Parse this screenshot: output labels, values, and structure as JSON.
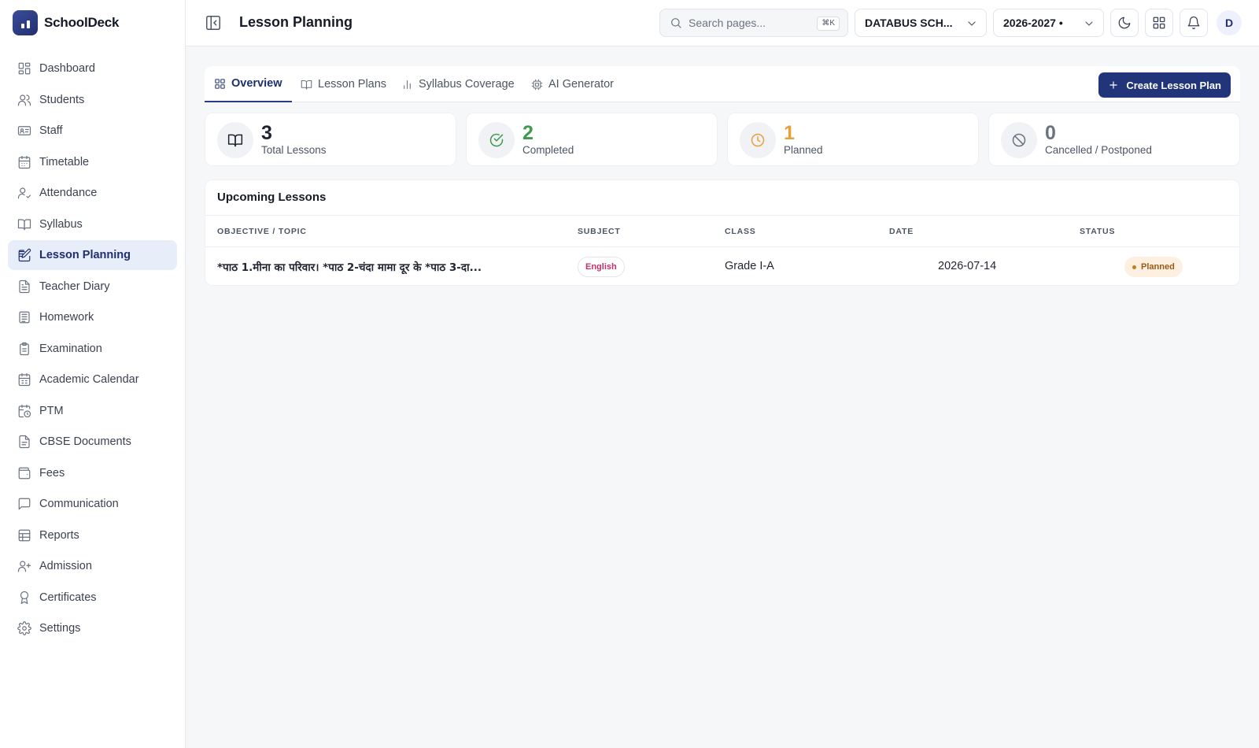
{
  "app": {
    "name": "SchoolDeck"
  },
  "sidebar": {
    "items": [
      {
        "label": "Dashboard",
        "icon": "dashboard-icon"
      },
      {
        "label": "Students",
        "icon": "users-icon"
      },
      {
        "label": "Staff",
        "icon": "id-card-icon"
      },
      {
        "label": "Timetable",
        "icon": "calendar-icon"
      },
      {
        "label": "Attendance",
        "icon": "user-check-icon"
      },
      {
        "label": "Syllabus",
        "icon": "book-open-icon"
      },
      {
        "label": "Lesson Planning",
        "icon": "edit-list-icon",
        "active": true
      },
      {
        "label": "Teacher Diary",
        "icon": "notebook-icon"
      },
      {
        "label": "Homework",
        "icon": "list-icon"
      },
      {
        "label": "Examination",
        "icon": "clipboard-icon"
      },
      {
        "label": "Academic Calendar",
        "icon": "calendar-days-icon"
      },
      {
        "label": "PTM",
        "icon": "calendar-clock-icon"
      },
      {
        "label": "CBSE Documents",
        "icon": "file-text-icon"
      },
      {
        "label": "Fees",
        "icon": "wallet-icon"
      },
      {
        "label": "Communication",
        "icon": "message-icon"
      },
      {
        "label": "Reports",
        "icon": "table-icon"
      },
      {
        "label": "Admission",
        "icon": "user-plus-icon"
      },
      {
        "label": "Certificates",
        "icon": "award-icon"
      },
      {
        "label": "Settings",
        "icon": "gear-icon"
      }
    ]
  },
  "header": {
    "title": "Lesson Planning",
    "search_placeholder": "Search pages...",
    "search_shortcut": "⌘K",
    "school": "DATABUS SCH...",
    "year": "2026-2027 •",
    "avatar_initial": "D"
  },
  "tabs": [
    {
      "label": "Overview",
      "icon": "grid-icon",
      "active": true
    },
    {
      "label": "Lesson Plans",
      "icon": "book-open-icon"
    },
    {
      "label": "Syllabus Coverage",
      "icon": "bar-chart-icon"
    },
    {
      "label": "AI Generator",
      "icon": "cpu-icon"
    }
  ],
  "create_button": "Create Lesson Plan",
  "stats": [
    {
      "value": "3",
      "label": "Total Lessons",
      "color": "#1f2430",
      "icon": "book-open-icon"
    },
    {
      "value": "2",
      "label": "Completed",
      "color": "#3f9a4e",
      "icon": "check-circle-icon"
    },
    {
      "value": "1",
      "label": "Planned",
      "color": "#e8a03a",
      "icon": "clock-icon"
    },
    {
      "value": "0",
      "label": "Cancelled / Postponed",
      "color": "#6b7280",
      "icon": "ban-icon"
    }
  ],
  "upcoming": {
    "title": "Upcoming Lessons",
    "columns": [
      "OBJECTIVE / TOPIC",
      "SUBJECT",
      "CLASS",
      "DATE",
      "STATUS"
    ],
    "rows": [
      {
        "topic": "*पाठ 1.मीना का परिवार। *पाठ 2-चंदा मामा दूर के *पाठ 3-दा...",
        "subject": "English",
        "class": "Grade I-A",
        "date": "2026-07-14",
        "status": "Planned"
      }
    ]
  }
}
